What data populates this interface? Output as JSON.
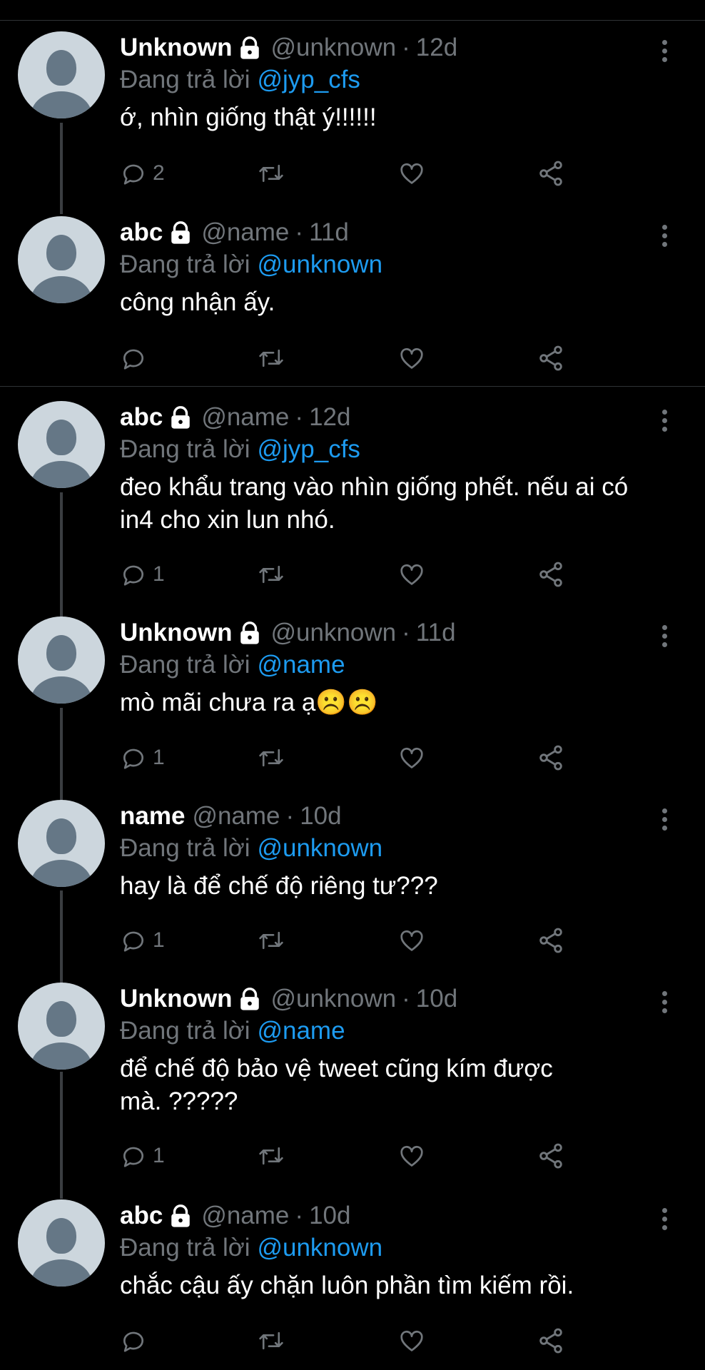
{
  "reply_prefix": "Đang trả lời",
  "tweets": [
    {
      "name": "Unknown",
      "handle": "@unknown",
      "separator": "·",
      "time": "12d",
      "reply_to": "@jyp_cfs",
      "lines": [
        "ớ, nhìn giống thật ý!!!!!!"
      ],
      "reply_count": "2"
    },
    {
      "name": "abc",
      "handle": "@name",
      "separator": "·",
      "time": "11d",
      "reply_to": "@unknown",
      "lines": [
        "công nhận ấy."
      ],
      "reply_count": ""
    },
    {
      "name": "abc",
      "handle": "@name",
      "separator": "·",
      "time": "12d",
      "reply_to": "@jyp_cfs",
      "lines": [
        "đeo khẩu trang vào nhìn giống phết. nếu ai có",
        "in4 cho xin lun nhó."
      ],
      "reply_count": "1"
    },
    {
      "name": "Unknown",
      "handle": "@unknown",
      "separator": "·",
      "time": "11d",
      "reply_to": "@name",
      "lines": [
        "mò mãi chưa ra ạ☹️☹️"
      ],
      "reply_count": "1"
    },
    {
      "name": "name",
      "handle": "@name",
      "separator": "·",
      "time": "10d",
      "reply_to": "@unknown",
      "lines": [
        "hay là để chế độ riêng tư???"
      ],
      "reply_count": "1"
    },
    {
      "name": "Unknown",
      "handle": "@unknown",
      "separator": "·",
      "time": "10d",
      "reply_to": "@name",
      "lines": [
        "để chế độ bảo vệ tweet cũng kím được",
        "mà. ?????"
      ],
      "reply_count": "1"
    },
    {
      "name": "abc",
      "handle": "@name",
      "separator": "·",
      "time": "10d",
      "reply_to": "@unknown",
      "lines": [
        "chắc cậu ấy chặn luôn phần tìm kiếm rồi."
      ],
      "reply_count": ""
    }
  ],
  "colors": {
    "background": "#000000",
    "text": "#ffffff",
    "muted": "#71767b",
    "mention": "#1d9bf0",
    "divider": "#2f3336"
  },
  "icons": [
    "lock-icon",
    "more-icon",
    "reply-icon",
    "retweet-icon",
    "like-icon",
    "share-icon"
  ]
}
